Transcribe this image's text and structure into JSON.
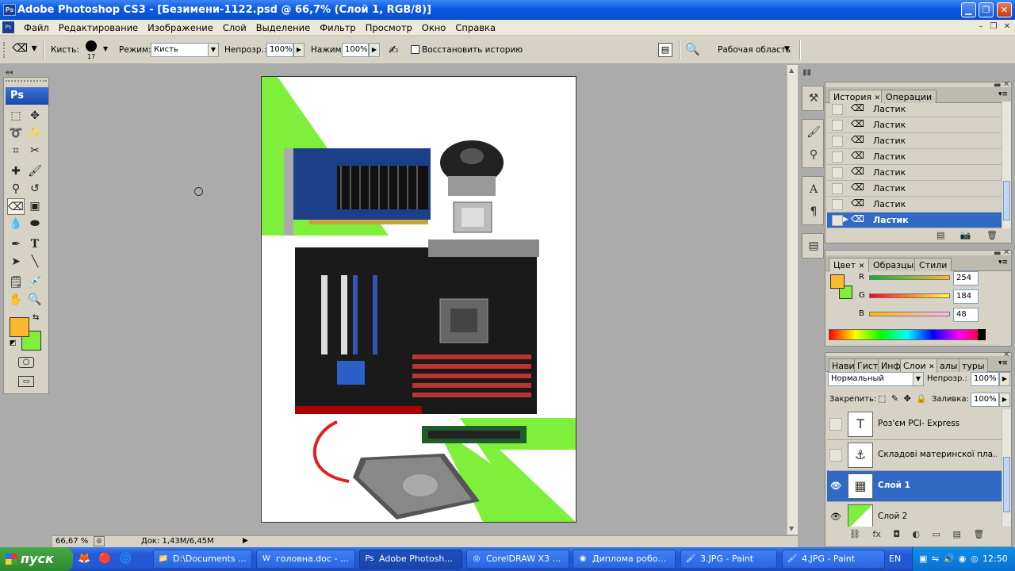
{
  "window": {
    "title": "Adobe Photoshop CS3 - [Безимени-1122.psd @ 66,7% (Слой 1, RGB/8)]"
  },
  "menu": [
    "Файл",
    "Редактирование",
    "Изображение",
    "Слой",
    "Выделение",
    "Фильтр",
    "Просмотр",
    "Окно",
    "Справка"
  ],
  "options": {
    "brush_label": "Кисть:",
    "brush_size": "17",
    "mode_label": "Режим:",
    "mode_value": "Кисть",
    "opacity_label": "Непрозр.:",
    "opacity_value": "100%",
    "flow_label": "Нажим:",
    "flow_value": "100%",
    "history_checkbox_label": "Восстановить историю",
    "workspace_label": "Рабочая область"
  },
  "colors": {
    "foreground": "#feb830",
    "background": "#7ef03c"
  },
  "history_panel": {
    "tabs": [
      "История",
      "Операции"
    ],
    "items": [
      {
        "label": "Ластик",
        "selected": false
      },
      {
        "label": "Ластик",
        "selected": false
      },
      {
        "label": "Ластик",
        "selected": false
      },
      {
        "label": "Ластик",
        "selected": false
      },
      {
        "label": "Ластик",
        "selected": false
      },
      {
        "label": "Ластик",
        "selected": false
      },
      {
        "label": "Ластик",
        "selected": false
      },
      {
        "label": "Ластик",
        "selected": true
      }
    ]
  },
  "color_panel": {
    "tabs": [
      "Цвет",
      "Образцы",
      "Стили"
    ],
    "r_label": "R",
    "r_value": "254",
    "g_label": "G",
    "g_value": "184",
    "b_label": "B",
    "b_value": "48"
  },
  "layers_panel": {
    "tabs": [
      "Нави",
      "Гист",
      "Инфо",
      "Слои",
      "алы",
      "туры"
    ],
    "blend_mode": "Нормальный",
    "opacity_label": "Непрозр.:",
    "opacity_value": "100%",
    "lock_label": "Закрепить:",
    "fill_label": "Заливка:",
    "fill_value": "100%",
    "layers": [
      {
        "name": "Роз'єм PCI- Express",
        "visible": false,
        "selected": false,
        "thumb": "T"
      },
      {
        "name": "Складові материнскої пла...",
        "visible": false,
        "selected": false,
        "thumb": "⚓"
      },
      {
        "name": "Слой 1",
        "visible": true,
        "selected": true,
        "thumb": "▦"
      },
      {
        "name": "Слой 2",
        "visible": true,
        "selected": false,
        "thumb": ""
      }
    ]
  },
  "status": {
    "zoom": "66,67 %",
    "doc": "Док: 1,43M/6,45M"
  },
  "taskbar": {
    "start": "пуск",
    "tasks": [
      "D:\\Documents ...",
      "головна.doc - ...",
      "Adobe Photosh...",
      "CorelDRAW X3 ...",
      "Диплома робо...",
      "3.JPG - Paint",
      "4.JPG - Paint"
    ],
    "lang": "EN",
    "time": "12:50"
  }
}
